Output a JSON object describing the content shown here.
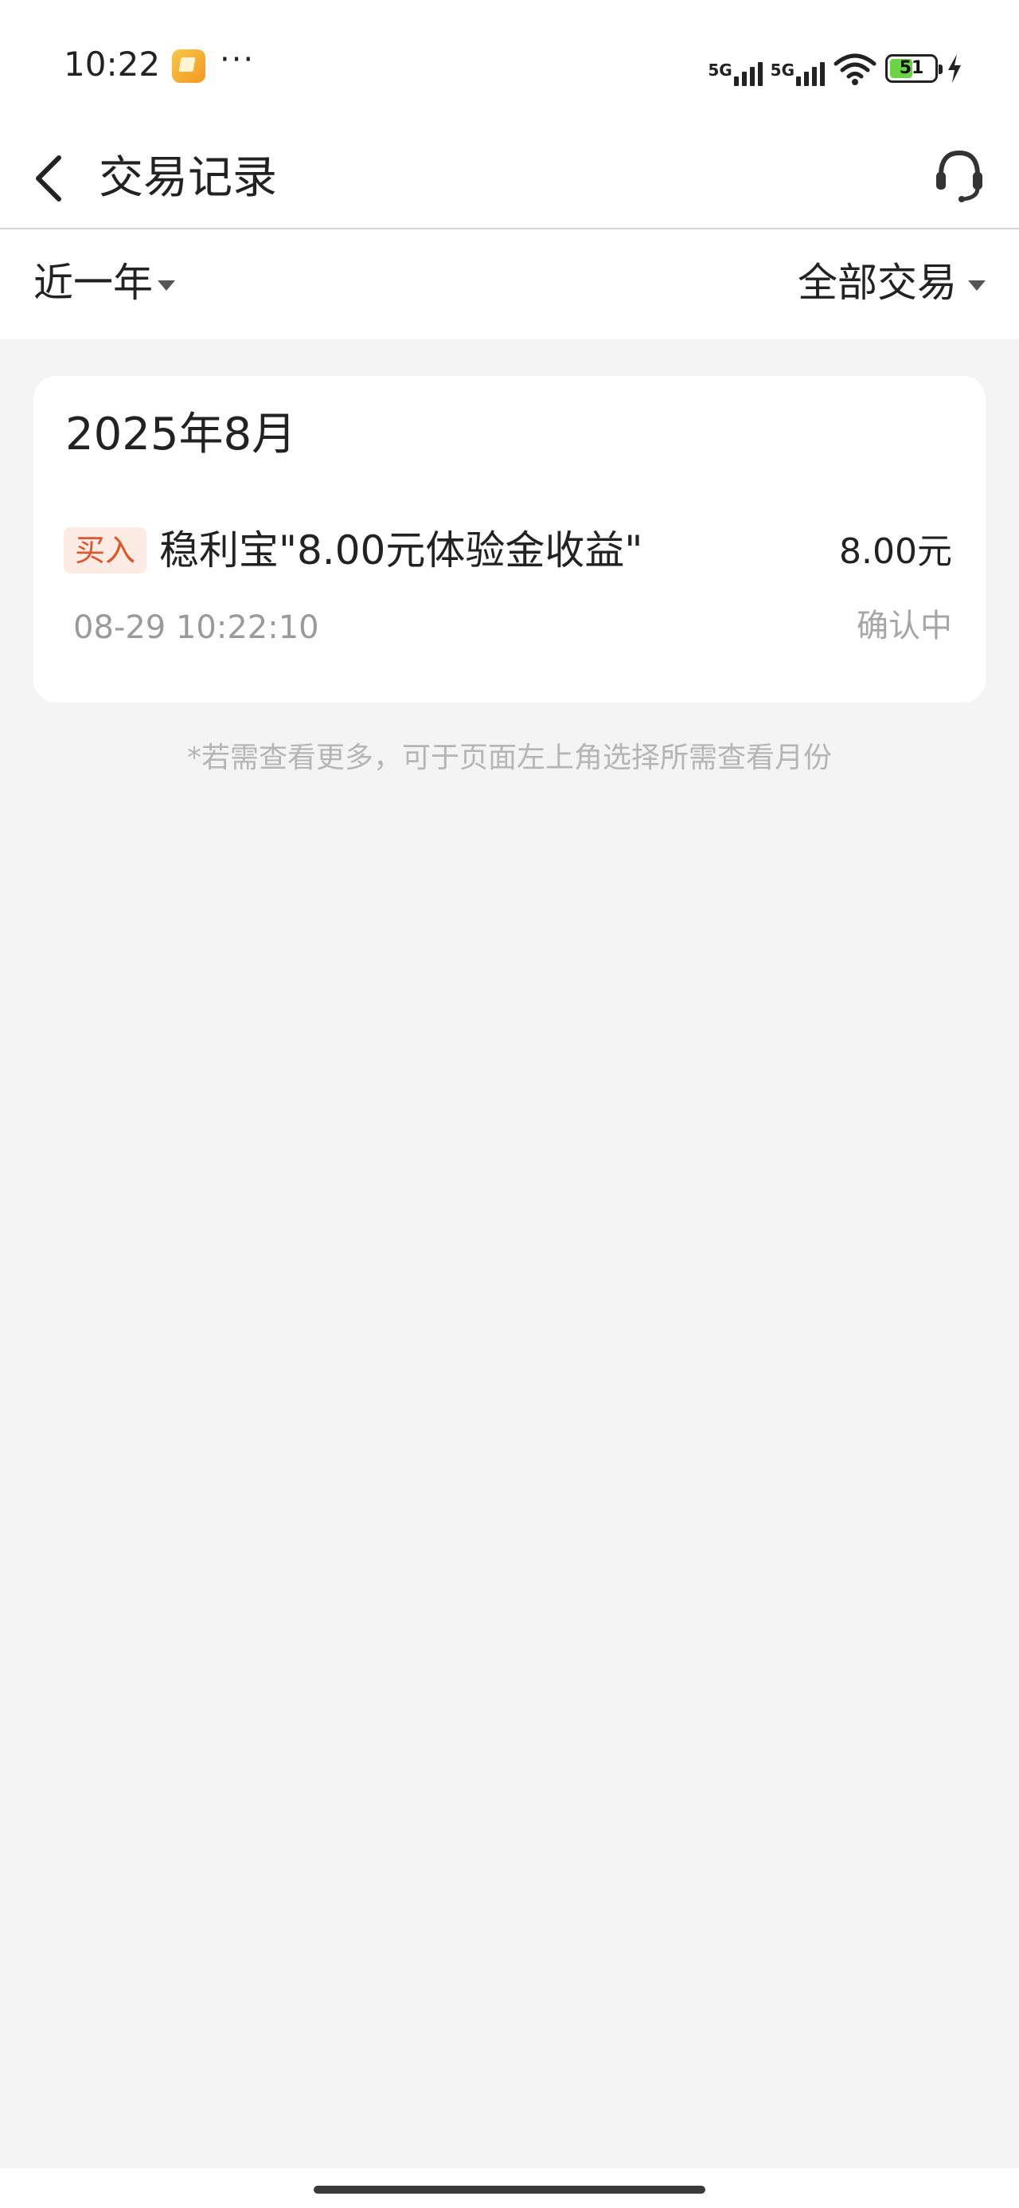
{
  "status_bar": {
    "time": "10:22",
    "more": "···",
    "net1": "5G",
    "net2": "5G",
    "battery": "51",
    "battery_level_percent": 51,
    "battery_color": "#6bd346"
  },
  "header": {
    "title": "交易记录",
    "back_icon": "chevron-left-icon",
    "service_icon": "headset-icon"
  },
  "filters": {
    "period": "近一年",
    "type": "全部交易"
  },
  "records": {
    "month": "2025年8月",
    "items": [
      {
        "tag": "买入",
        "tag_color": "#e0562a",
        "name": "稳利宝\"8.00元体验金收益\"",
        "amount": "8.00元",
        "time": "08-29 10:22:10",
        "status": "确认中"
      }
    ]
  },
  "hint": "*若需查看更多，可于页面左上角选择所需查看月份",
  "colors": {
    "background": "#f4f4f4",
    "card": "#ffffff",
    "text": "#222222",
    "muted": "#9a9a9a"
  }
}
